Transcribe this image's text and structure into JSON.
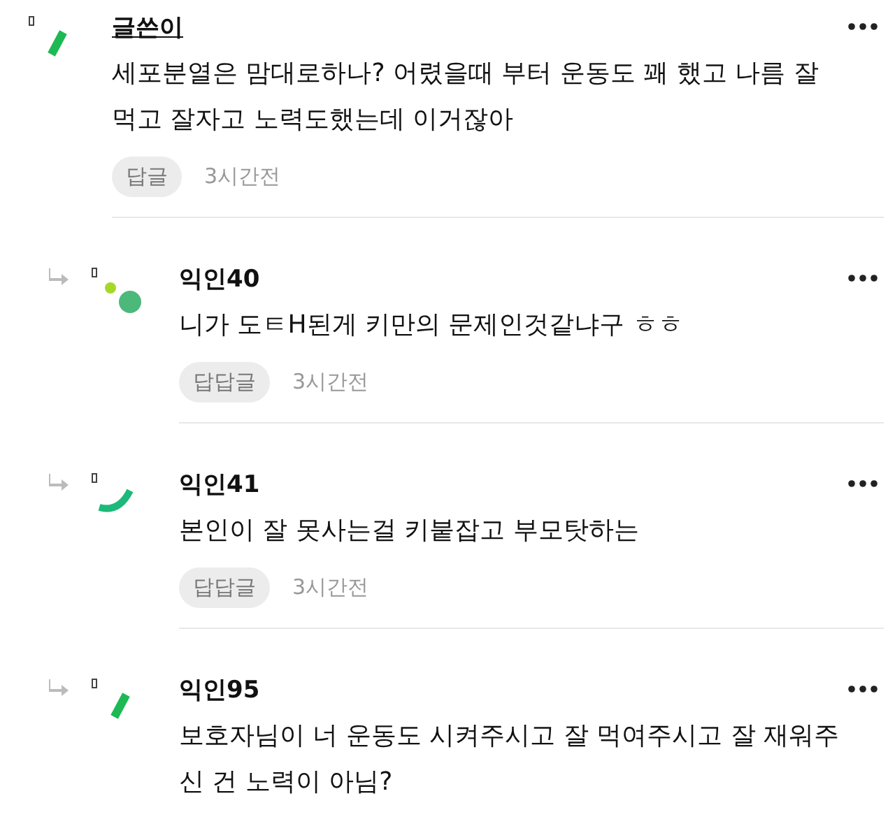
{
  "comments": [
    {
      "kind": "post",
      "author": "글쓴이",
      "avatar": {
        "kind": "stroke"
      },
      "body": "세포분열은 맘대로하나? 어렸을때 부터 운동도 꽤 했고 나름 잘먹고 잘자고 노력도했는데 이거잖아",
      "reply_label": "답글",
      "time": "3시간전"
    },
    {
      "kind": "reply",
      "author": "익인40",
      "avatar": {
        "kind": "dots"
      },
      "body": "니가 도ㅌH된게 키만의 문제인것같냐구 ㅎㅎ",
      "reply_label": "답답글",
      "time": "3시간전"
    },
    {
      "kind": "reply",
      "author": "익인41",
      "avatar": {
        "kind": "arc"
      },
      "body": "본인이 잘 못사는걸 키붙잡고 부모탓하는",
      "reply_label": "답답글",
      "time": "3시간전"
    },
    {
      "kind": "reply",
      "author": "익인95",
      "avatar": {
        "kind": "stroke"
      },
      "body": "보호자님이 너 운동도 시켜주시고 잘 먹여주시고 잘 재워주신 건 노력이 아님?"
    }
  ]
}
